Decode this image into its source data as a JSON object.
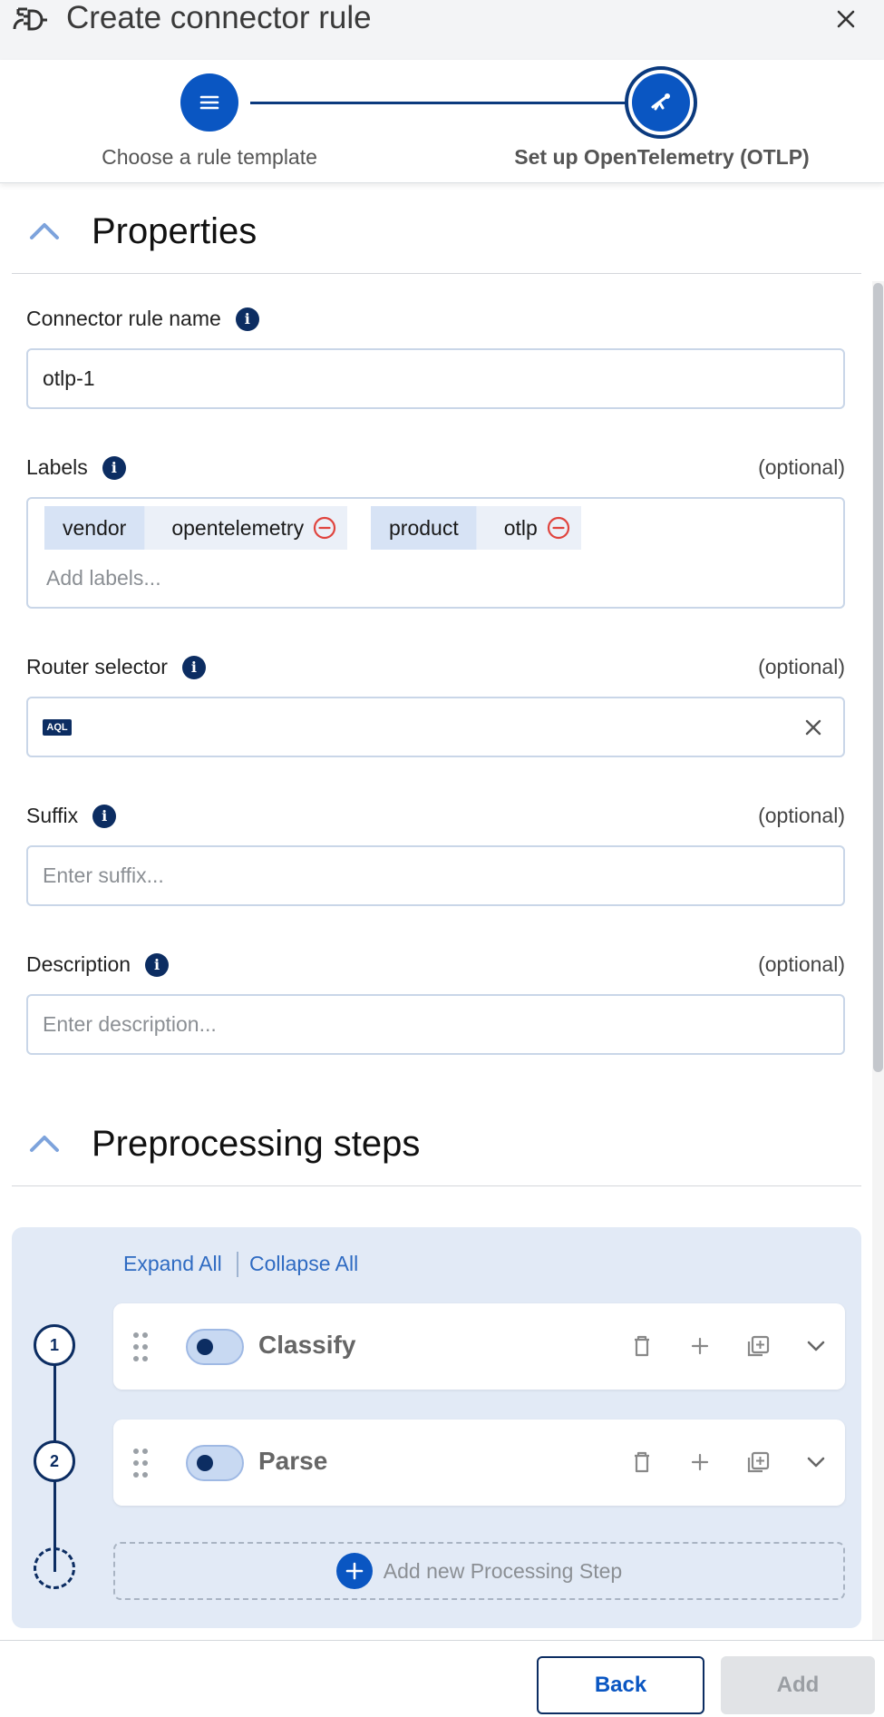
{
  "header": {
    "title": "Create connector rule",
    "plug_icon": "plug-icon",
    "close_icon": "close-icon"
  },
  "stepper": {
    "steps": [
      {
        "label": "Choose a rule template",
        "icon": "list-icon",
        "state": "completed"
      },
      {
        "label": "Set up OpenTelemetry (OTLP)",
        "icon": "telescope-icon",
        "state": "current"
      }
    ],
    "accent": "#0a56c2"
  },
  "properties": {
    "title": "Properties",
    "connector_rule_name": {
      "label": "Connector rule name",
      "value": "otlp-1"
    },
    "labels": {
      "label": "Labels",
      "optional": "(optional)",
      "chips": [
        {
          "key": "vendor",
          "value": "opentelemetry"
        },
        {
          "key": "product",
          "value": "otlp"
        }
      ],
      "placeholder": "Add labels..."
    },
    "router_selector": {
      "label": "Router selector",
      "optional": "(optional)",
      "badge": "AQL",
      "value": ""
    },
    "suffix": {
      "label": "Suffix",
      "optional": "(optional)",
      "placeholder": "Enter suffix..."
    },
    "description": {
      "label": "Description",
      "optional": "(optional)",
      "placeholder": "Enter description..."
    }
  },
  "preprocessing": {
    "title": "Preprocessing steps",
    "expand_all": "Expand All",
    "collapse_all": "Collapse All",
    "steps": [
      {
        "number": "1",
        "name": "Classify",
        "enabled": true
      },
      {
        "number": "2",
        "name": "Parse",
        "enabled": true
      }
    ],
    "add_step": "Add new Processing Step"
  },
  "footer": {
    "back": "Back",
    "add": "Add"
  }
}
